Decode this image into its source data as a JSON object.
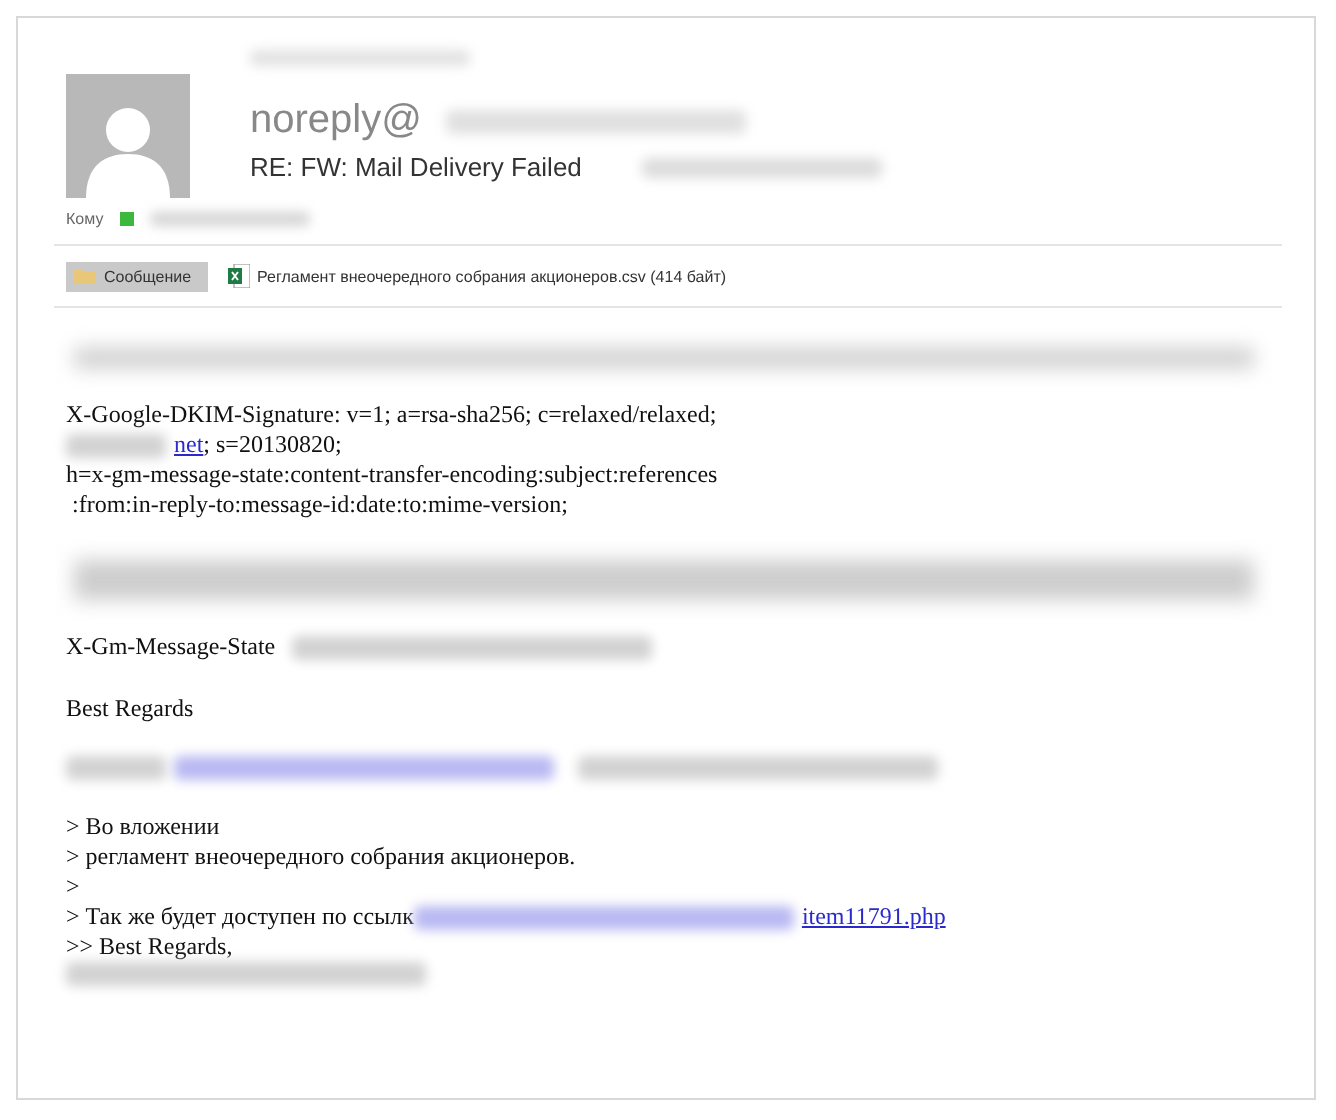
{
  "message": {
    "from": "noreply@",
    "subject": "RE: FW: Mail Delivery Failed",
    "to_label": "Кому",
    "recipient": {
      "color": "#3cb83c"
    }
  },
  "attachments": [
    {
      "kind": "message",
      "label": "Сообщение",
      "selected": true
    },
    {
      "kind": "file",
      "label": "Регламент внеочередного собрания акционеров.csv (414 байт)",
      "selected": false
    }
  ],
  "body": [
    {
      "kind": "thin_blur"
    },
    {
      "kind": "paragraph",
      "lines": [
        [
          {
            "kind": "text",
            "text": "X-Google-DKIM-Signature: v=1; a=rsa-sha256; c=relaxed/relaxed;"
          }
        ],
        [
          {
            "kind": "blur"
          },
          {
            "kind": "link",
            "text": "net"
          },
          {
            "kind": "text",
            "text": "; s=20130820;"
          }
        ],
        [
          {
            "kind": "text",
            "text": "h=x-gm-message-state:content-transfer-encoding:subject:references"
          }
        ],
        [
          {
            "kind": "text",
            "text": " :from:in-reply-to:message-id:date:to:mime-version;"
          }
        ]
      ]
    },
    {
      "kind": "thick_blur"
    },
    {
      "kind": "paragraph",
      "lines": [
        [
          {
            "kind": "text",
            "text": "X-Gm-Message-State"
          },
          {
            "kind": "blur"
          }
        ]
      ]
    },
    {
      "kind": "paragraph",
      "lines": [
        [
          {
            "kind": "text",
            "text": "Best Regards"
          }
        ]
      ]
    },
    {
      "kind": "paragraph",
      "lines": [
        [
          {
            "kind": "blur"
          },
          {
            "kind": "blur_link"
          },
          {
            "kind": "blur"
          }
        ]
      ]
    },
    {
      "kind": "paragraph",
      "lines": [
        [
          {
            "kind": "text",
            "text": "> Во вложении"
          }
        ],
        [
          {
            "kind": "text",
            "text": "> регламент внеочередного собрания акционеров."
          }
        ],
        [
          {
            "kind": "text",
            "text": ">"
          }
        ],
        [
          {
            "kind": "text",
            "text": "> Так же будет доступен по ссылк"
          },
          {
            "kind": "blur_link"
          },
          {
            "kind": "link",
            "text": "item11791.php"
          }
        ],
        [
          {
            "kind": "text",
            "text": ">> Best Regards,"
          }
        ],
        [
          {
            "kind": "blur"
          }
        ]
      ]
    }
  ]
}
